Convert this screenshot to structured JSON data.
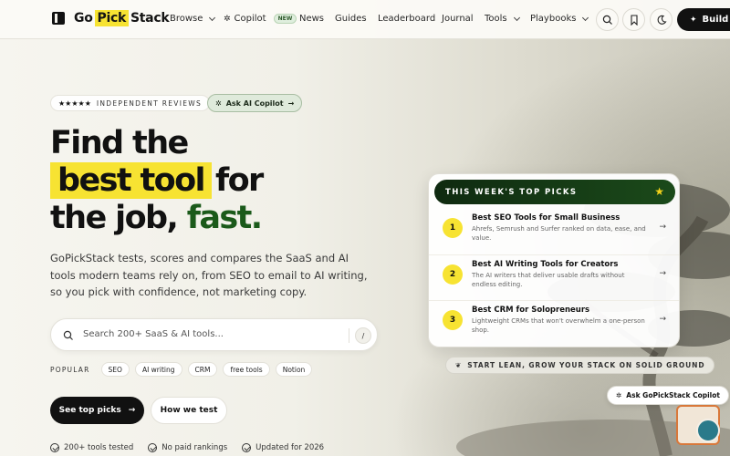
{
  "nav": {
    "logo_part1": "Go",
    "logo_highlight": "Pick",
    "logo_part2": "Stack",
    "browse": "Browse",
    "copilot": "Copilot",
    "copilot_badge": "NEW",
    "news": "News",
    "guides": "Guides",
    "leaderboard": "Leaderboard",
    "journal": "Journal",
    "tools": "Tools",
    "playbooks": "Playbooks",
    "build_button": "Build my"
  },
  "hero": {
    "stars": "★★★★★",
    "reviews_label": "INDEPENDENT REVIEWS",
    "ask_copilot": "Ask AI Copilot",
    "headline_1": "Find the",
    "headline_highlight": "best tool",
    "headline_2": "for",
    "headline_3": "the job,",
    "headline_fast": "fast.",
    "lede": "GoPickStack tests, scores and compares the SaaS and AI tools modern teams rely on, from SEO to email to AI writing, so you pick with confidence, not marketing copy.",
    "search_placeholder": "Search 200+ SaaS & AI tools...",
    "search_shortcut": "/",
    "popular_label": "POPULAR",
    "popular_chips": [
      "SEO",
      "AI writing",
      "CRM",
      "free tools",
      "Notion"
    ],
    "primary_cta": "See top picks",
    "secondary_cta": "How we test",
    "trust": [
      "200+ tools tested",
      "No paid rankings",
      "Updated for 2026"
    ]
  },
  "picks": {
    "title": "THIS WEEK'S TOP PICKS",
    "items": [
      {
        "num": "1",
        "title": "Best SEO Tools for Small Business",
        "desc": "Ahrefs, Semrush and Surfer ranked on data, ease, and value."
      },
      {
        "num": "2",
        "title": "Best AI Writing Tools for Creators",
        "desc": "The AI writers that deliver usable drafts without endless editing."
      },
      {
        "num": "3",
        "title": "Best CRM for Solopreneurs",
        "desc": "Lightweight CRMs that won't overwhelm a one-person shop."
      }
    ]
  },
  "ground_pill": "START LEAN, GROW YOUR STACK ON SOLID GROUND",
  "copilot_float": "Ask GoPickStack Copilot",
  "colors": {
    "accent_yellow": "#f7e332",
    "brand_green": "#1b5a1a",
    "dark": "#111111"
  }
}
